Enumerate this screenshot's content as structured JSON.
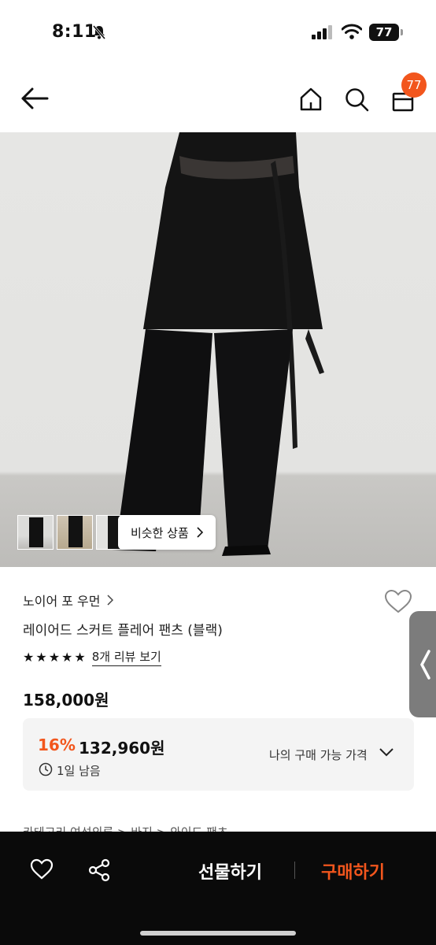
{
  "status": {
    "time": "8:11",
    "battery": "77"
  },
  "header": {
    "cart_count": "77"
  },
  "gallery": {
    "similar_label": "비슷한 상품"
  },
  "product": {
    "brand": "노이어 포 우먼",
    "name": "레이어드 스커트 플레어 팬츠 (블랙)",
    "review_link": "8개 리뷰 보기",
    "rating_stars": 5,
    "price": "158,000원"
  },
  "discount": {
    "rate": "16%",
    "price": "132,960원",
    "time_left": "1일 남음",
    "my_price_label": "나의 구매 가능 가격"
  },
  "cut_text": "카테고리   여성의류 > 바지 > 와이드 팬츠",
  "bottom": {
    "gift_label": "선물하기",
    "buy_label": "구매하기"
  },
  "colors": {
    "accent": "#f2561d",
    "bottom_bar": "#0a0a0a",
    "side_tab": "#7c7c7c"
  }
}
